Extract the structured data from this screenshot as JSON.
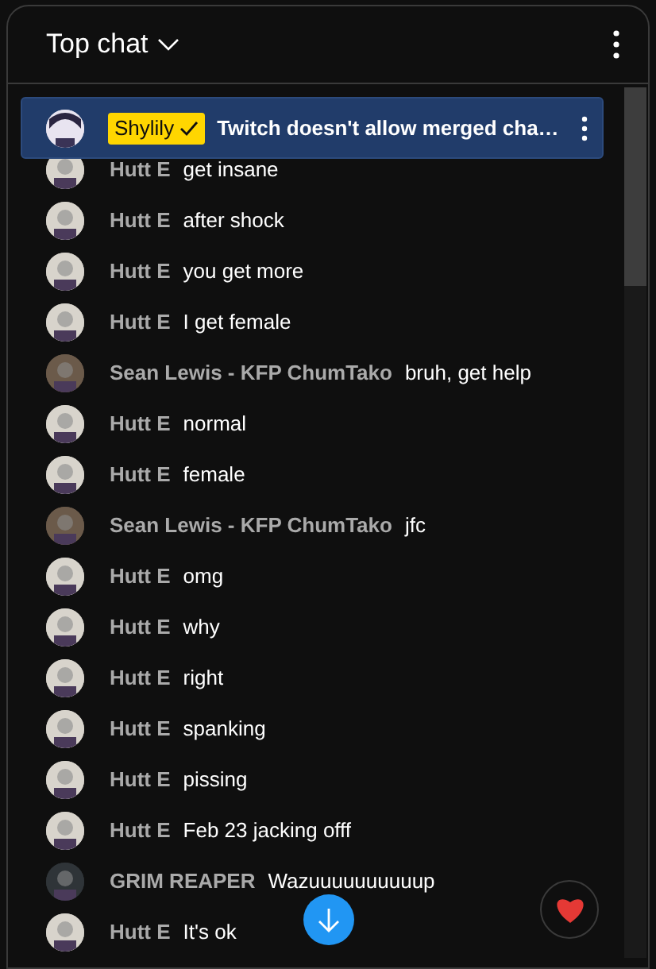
{
  "header": {
    "title": "Top chat"
  },
  "pinned": {
    "author": "Shylily",
    "verified": true,
    "text": "Twitch doesn't allow merged cha…"
  },
  "messages": [
    {
      "author": "Hutt E",
      "text": "get insane",
      "color": "#d8d4cc"
    },
    {
      "author": "Hutt E",
      "text": "after shock",
      "color": "#d8d4cc"
    },
    {
      "author": "Hutt E",
      "text": "you get more",
      "color": "#d8d4cc"
    },
    {
      "author": "Hutt E",
      "text": "I get female",
      "color": "#d8d4cc"
    },
    {
      "author": "Sean Lewis - KFP ChumTako",
      "text": "bruh, get help",
      "color": "#6b5a4a"
    },
    {
      "author": "Hutt E",
      "text": "normal",
      "color": "#d8d4cc"
    },
    {
      "author": "Hutt E",
      "text": "female",
      "color": "#d8d4cc"
    },
    {
      "author": "Sean Lewis - KFP ChumTako",
      "text": "jfc",
      "color": "#6b5a4a"
    },
    {
      "author": "Hutt E",
      "text": "omg",
      "color": "#d8d4cc"
    },
    {
      "author": "Hutt E",
      "text": "why",
      "color": "#d8d4cc"
    },
    {
      "author": "Hutt E",
      "text": "right",
      "color": "#d8d4cc"
    },
    {
      "author": "Hutt E",
      "text": "spanking",
      "color": "#d8d4cc"
    },
    {
      "author": "Hutt E",
      "text": "pissing",
      "color": "#d8d4cc"
    },
    {
      "author": "Hutt E",
      "text": "Feb 23 jacking offf",
      "color": "#d8d4cc"
    },
    {
      "author": "GRIM REAPER",
      "text": "Wazuuuuuuuuuup",
      "color": "#2f3438"
    },
    {
      "author": "Hutt E",
      "text": "It's ok",
      "color": "#d8d4cc"
    }
  ]
}
